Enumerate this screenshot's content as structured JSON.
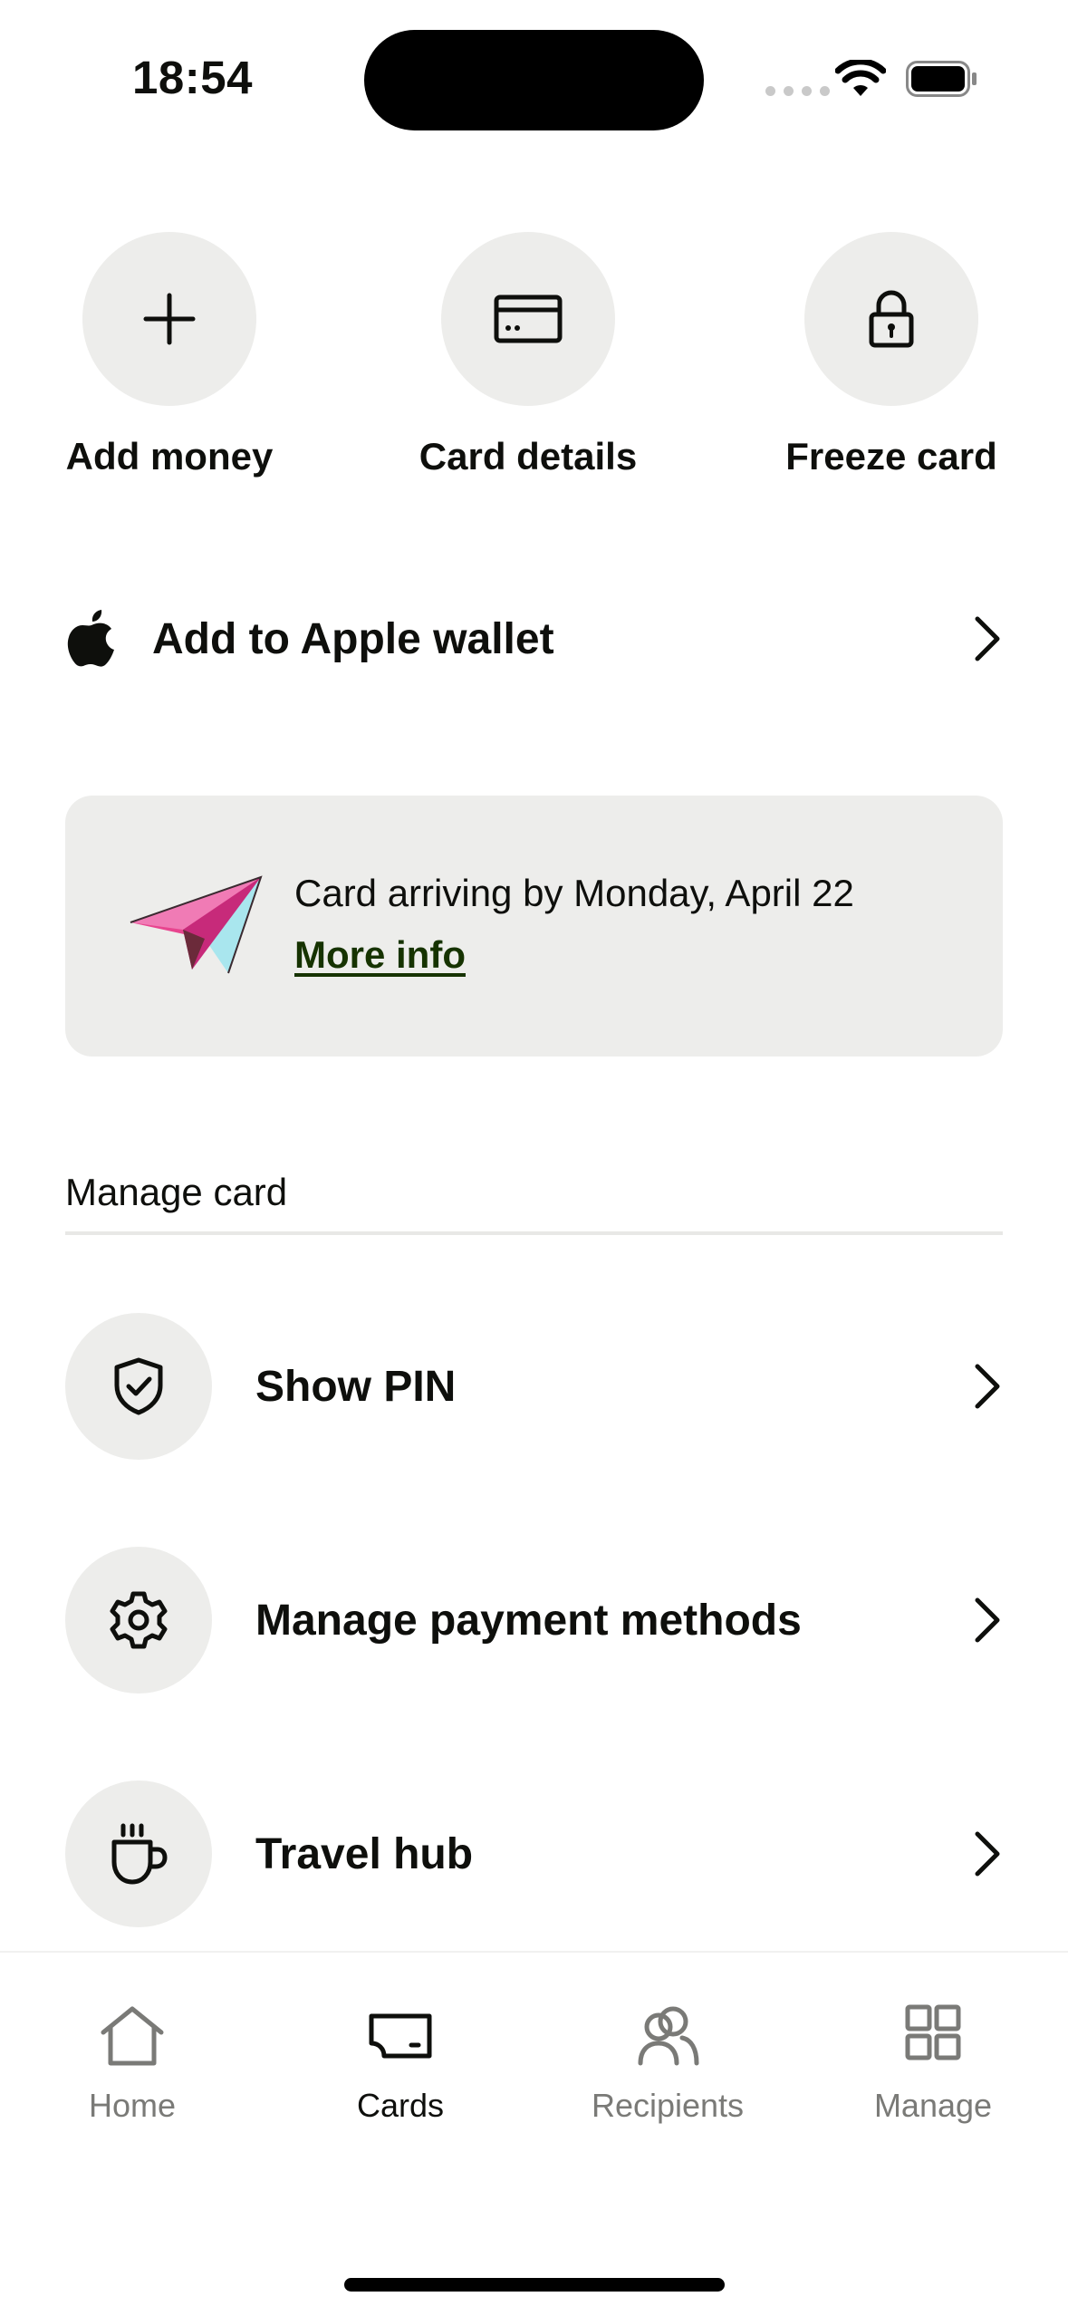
{
  "status_bar": {
    "time": "18:54"
  },
  "quick_actions": [
    {
      "label": "Add money",
      "icon": "plus-icon"
    },
    {
      "label": "Card details",
      "icon": "card-icon"
    },
    {
      "label": "Freeze card",
      "icon": "lock-icon"
    }
  ],
  "wallet": {
    "label": "Add to Apple wallet",
    "icon": "apple-icon"
  },
  "banner": {
    "message": "Card arriving by Monday, April 22",
    "link": "More info",
    "icon": "paper-plane-icon"
  },
  "manage_section": {
    "title": "Manage card",
    "items": [
      {
        "label": "Show PIN",
        "icon": "shield-check-icon"
      },
      {
        "label": "Manage payment methods",
        "icon": "gear-icon"
      },
      {
        "label": "Travel hub",
        "icon": "cup-icon"
      }
    ]
  },
  "tab_bar": {
    "active": "Cards",
    "items": [
      {
        "label": "Home",
        "icon": "home-icon"
      },
      {
        "label": "Cards",
        "icon": "card-icon"
      },
      {
        "label": "Recipients",
        "icon": "people-icon"
      },
      {
        "label": "Manage",
        "icon": "grid-icon"
      }
    ]
  },
  "colors": {
    "text": "#0e0f0c",
    "surface": "#ededeb",
    "link": "#163300",
    "inactive_tab": "#7a7a77"
  }
}
